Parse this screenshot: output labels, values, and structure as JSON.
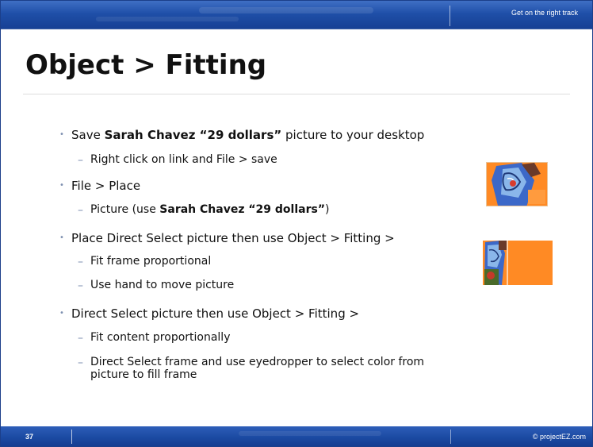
{
  "header": {
    "tagline": "Get on the right track"
  },
  "title": "Object > Fitting",
  "bullets": [
    {
      "segments": [
        "Save ",
        "Sarah Chavez “29 dollars”",
        " picture to your desktop"
      ],
      "sub": [
        {
          "text": "Right click on link and File > save"
        }
      ]
    },
    {
      "segments": [
        "File > Place"
      ],
      "sub": [
        {
          "segments": [
            "Picture (use ",
            "Sarah Chavez “29 dollars”",
            ")"
          ]
        }
      ]
    },
    {
      "segments": [
        "Place Direct Select picture then use Object > Fitting >"
      ],
      "sub": [
        {
          "text": "Fit frame proportional"
        },
        {
          "text": "Use hand to move picture"
        }
      ]
    },
    {
      "segments": [
        "Direct Select picture then use Object > Fitting >"
      ],
      "sub": [
        {
          "text": "Fit content proportionally"
        },
        {
          "lines": [
            "Direct Select frame and use eyedropper to select color from",
            "picture to fill frame"
          ]
        }
      ]
    }
  ],
  "footer": {
    "slide_number": "37",
    "copyright": "© projectEZ.com"
  },
  "colors": {
    "bar_blue": "#1f4fa8",
    "picture_orange": "#ff8a24",
    "bullet_marker": "#7d8fb0"
  }
}
